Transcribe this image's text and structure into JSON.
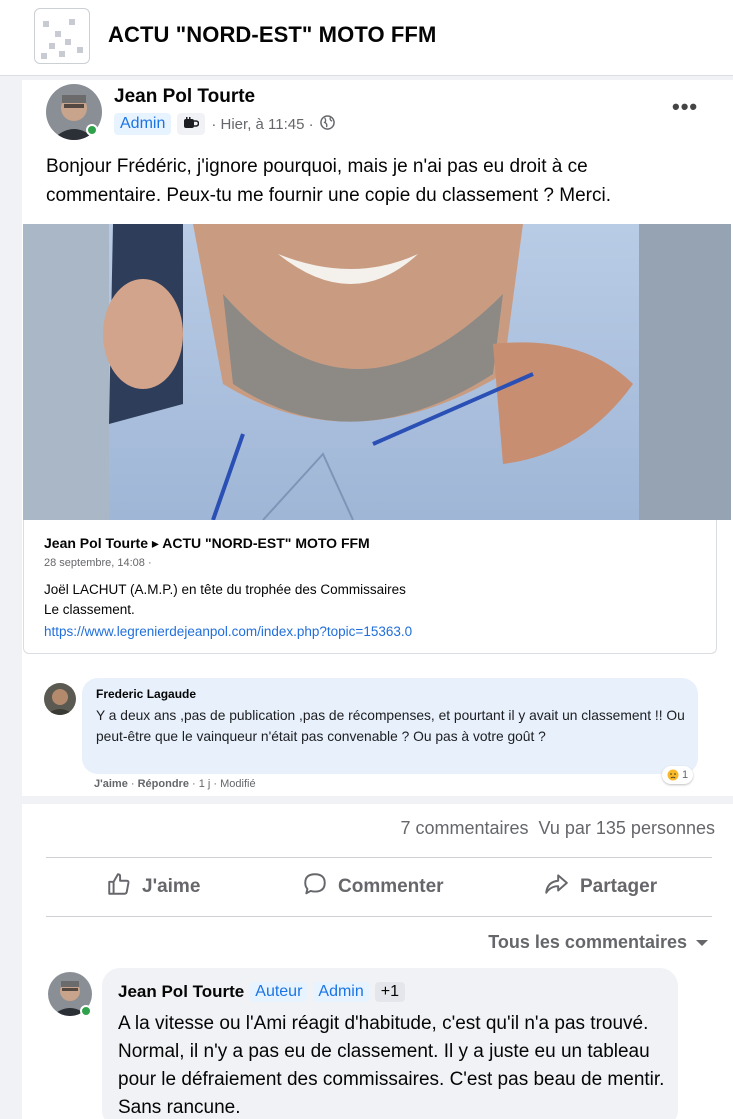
{
  "group": {
    "name": "ACTU \"NORD-EST\" MOTO FFM"
  },
  "post": {
    "author": "Jean Pol Tourte",
    "badge_admin": "Admin",
    "timestamp": "· Hier, à 11:45 ·",
    "text": "Bonjour Frédéric, j'ignore pourquoi, mais je n'ai pas eu droit à ce commentaire. Peux-tu me fournir une copie du classement ? Merci.",
    "more_label": "•••"
  },
  "shared": {
    "title": "Jean Pol Tourte ▸ ACTU \"NORD-EST\" MOTO FFM",
    "date": "28 septembre, 14:08 ·",
    "line1": "Joël LACHUT (A.M.P.) en tête du trophée des Commissaires",
    "line2": "Le classement.",
    "link": "https://www.legrenierdejeanpol.com/index.php?topic=15363.0"
  },
  "shared_comment": {
    "author": "Frederic Lagaude",
    "text": "Y a deux ans ,pas de publication ,pas de récompenses, et pourtant il y avait un classement !! Ou peut-être que le vainqueur n'était pas convenable ? Ou pas à votre goût ?",
    "like": "J'aime",
    "reply": "Répondre",
    "meta": "· 1 j · Modifié",
    "reaction_count": "1"
  },
  "stats": {
    "comments": "7 commentaires",
    "views": "Vu par 135 personnes"
  },
  "actions": {
    "like": "J'aime",
    "comment": "Commenter",
    "share": "Partager"
  },
  "sort": {
    "label": "Tous les commentaires"
  },
  "comment": {
    "author": "Jean Pol Tourte",
    "badge_author": "Auteur",
    "badge_admin": "Admin",
    "badge_more": "+1",
    "text": "A la vitesse ou l'Ami réagit d'habitude, c'est qu'il n'a pas trouvé. Normal, il n'y a pas eu de classement. Il y a juste eu un tableau pour le défraiement des commissaires. C'est pas beau de mentir. Sans rancune."
  },
  "colors": {
    "accent": "#1b74e4",
    "link": "#216fdb",
    "online": "#31a24c",
    "secondary_text": "#65676b"
  }
}
